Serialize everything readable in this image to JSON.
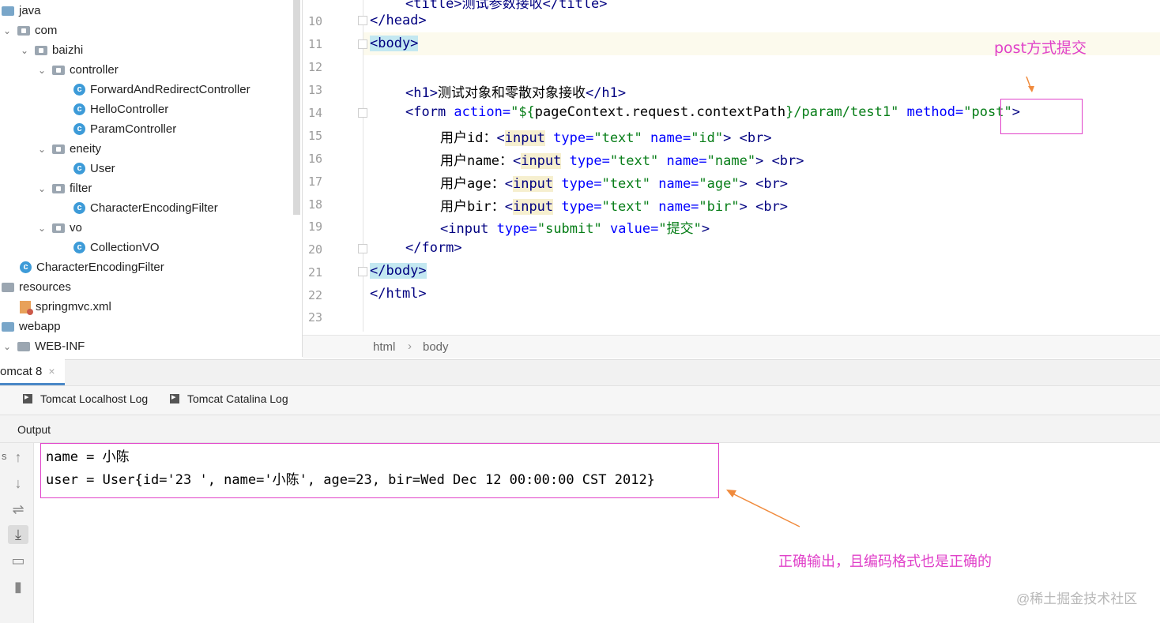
{
  "tree": {
    "items": [
      {
        "label": "java",
        "icon": "folder-blue-icon"
      },
      {
        "label": "com",
        "icon": "package-icon"
      },
      {
        "label": "baizhi",
        "icon": "package-icon"
      },
      {
        "label": "controller",
        "icon": "package-icon"
      },
      {
        "label": "ForwardAndRedirectController",
        "icon": "class-icon"
      },
      {
        "label": "HelloController",
        "icon": "class-icon"
      },
      {
        "label": "ParamController",
        "icon": "class-icon"
      },
      {
        "label": "eneity",
        "icon": "package-icon"
      },
      {
        "label": "User",
        "icon": "class-icon"
      },
      {
        "label": "filter",
        "icon": "package-icon"
      },
      {
        "label": "CharacterEncodingFilter",
        "icon": "class-icon"
      },
      {
        "label": "vo",
        "icon": "package-icon"
      },
      {
        "label": "CollectionVO",
        "icon": "class-icon"
      },
      {
        "label": "CharacterEncodingFilter",
        "icon": "class-icon"
      },
      {
        "label": "resources",
        "icon": "folder-icon"
      },
      {
        "label": "springmvc.xml",
        "icon": "xml-file-icon"
      },
      {
        "label": "webapp",
        "icon": "folder-web-icon"
      },
      {
        "label": "WEB-INF",
        "icon": "folder-icon"
      }
    ],
    "class_glyph": "c"
  },
  "editor": {
    "line_numbers": [
      "10",
      "11",
      "12",
      "13",
      "14",
      "15",
      "16",
      "17",
      "18",
      "19",
      "20",
      "21",
      "22",
      "23"
    ],
    "lines": {
      "l10_head": "</head>",
      "l11_body": "<body>",
      "l13_open": "<h1>",
      "l13_text": "测试对象和零散对象接收",
      "l13_close": "</h1>",
      "l14_tag": "<form",
      "l14_attr1": " action=",
      "l14_val1": "\"${",
      "l14_expr": "pageContext.request.contextPath",
      "l14_val1b": "}/param/test1\"",
      "l14_attr2": " method=",
      "l14_val2": "\"post\"",
      "l14_end": ">",
      "l15_label": "用户id：",
      "l16_label": "用户name：",
      "l17_label": "用户age：",
      "l18_label": "用户bir：",
      "input_tag": "input",
      "type_attr": " type=",
      "text_val": "\"text\"",
      "name_attr": " name=",
      "name_id": "\"id\"",
      "name_name": "\"name\"",
      "name_age": "\"age\"",
      "name_bir": "\"bir\"",
      "br": "<br>",
      "l19_tag": "<input",
      "submit_val": "\"submit\"",
      "value_attr": " value=",
      "submit_label": "\"提交\"",
      "l20_form_close": "</form>",
      "l21_body_close": "</body>",
      "l22_html_close": "</html>"
    },
    "breadcrumb": [
      "html",
      "body"
    ],
    "breadcrumb_sep": "›",
    "top_partial": "<title>测试参数接收</title>"
  },
  "annotations": {
    "post_note": "post方式提交",
    "output_note": "正确输出，且编码格式也是正确的",
    "annotation_color": "#e041c9",
    "arrow_color": "#f08a3c"
  },
  "run_panel": {
    "tab_label": "omcat 8",
    "tab_close": "×",
    "log_tabs": [
      "Tomcat Localhost Log",
      "Tomcat Catalina Log"
    ],
    "output_label": "Output",
    "output_lines": [
      "name = 小陈",
      "user = User{id='23 ', name='小陈', age=23, bir=Wed Dec 12 00:00:00 CST 2012}"
    ],
    "side_glyph": "s",
    "tools": [
      "up-arrow-icon",
      "down-arrow-icon",
      "soft-wrap-icon",
      "scroll-to-end-icon",
      "print-icon",
      "trash-icon"
    ]
  },
  "watermark": "@稀土掘金技术社区"
}
